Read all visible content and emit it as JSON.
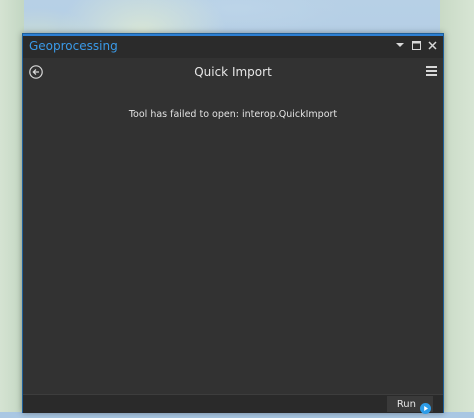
{
  "window": {
    "title": "Geoprocessing",
    "controls": [
      "dropdown",
      "maximize",
      "close"
    ]
  },
  "header": {
    "back_icon": "back-arrow-circle-icon",
    "title": "Quick Import",
    "menu_icon": "hamburger-menu-icon"
  },
  "main": {
    "message": "Tool has failed to open: interop.QuickImport"
  },
  "footer": {
    "run_label": "Run",
    "run_icon": "run-play-circle-icon"
  },
  "colors": {
    "pane_background": "#323232",
    "title_accent": "#3a9ae8",
    "run_icon": "#2d9ce8"
  }
}
